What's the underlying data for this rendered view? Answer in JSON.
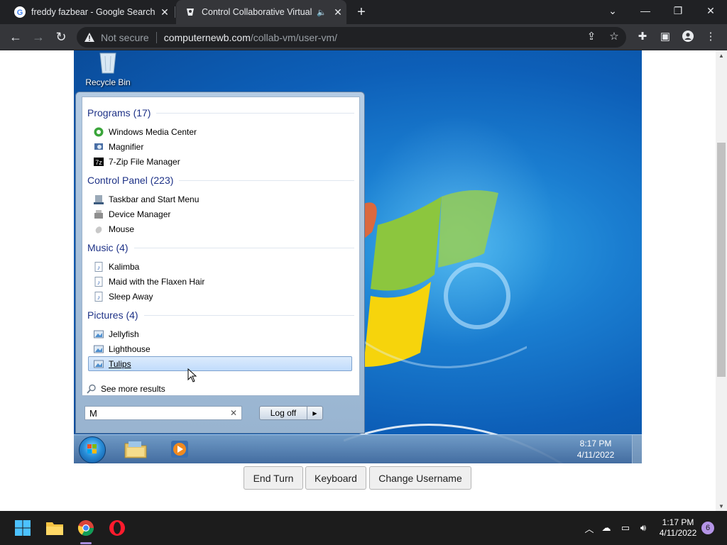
{
  "browser": {
    "tabs": [
      {
        "title": "freddy fazbear - Google Search",
        "favicon": "google-g-icon",
        "active": false
      },
      {
        "title": "Control Collaborative Virtual",
        "favicon": "collabvm-icon",
        "active": true
      }
    ],
    "security_label": "Not secure",
    "url_host": "computernewb.com",
    "url_path": "/collab-vm/user-vm/"
  },
  "desktop": {
    "recycle_bin_label": "Recycle Bin"
  },
  "start_menu": {
    "categories": [
      {
        "heading": "Programs (17)",
        "items": [
          {
            "label": "Windows Media Center",
            "icon": "media-center-icon"
          },
          {
            "label": "Magnifier",
            "icon": "magnifier-icon"
          },
          {
            "label": "7-Zip File Manager",
            "icon": "7zip-icon"
          }
        ]
      },
      {
        "heading": "Control Panel (223)",
        "items": [
          {
            "label": "Taskbar and Start Menu",
            "icon": "taskbar-icon"
          },
          {
            "label": "Device Manager",
            "icon": "device-manager-icon"
          },
          {
            "label": "Mouse",
            "icon": "mouse-icon"
          }
        ]
      },
      {
        "heading": "Music (4)",
        "items": [
          {
            "label": "Kalimba",
            "icon": "music-file-icon"
          },
          {
            "label": "Maid with the Flaxen Hair",
            "icon": "music-file-icon"
          },
          {
            "label": "Sleep Away",
            "icon": "music-file-icon"
          }
        ]
      },
      {
        "heading": "Pictures (4)",
        "items": [
          {
            "label": "Jellyfish",
            "icon": "picture-file-icon"
          },
          {
            "label": "Lighthouse",
            "icon": "picture-file-icon"
          },
          {
            "label": "Tulips",
            "icon": "picture-file-icon",
            "selected": true
          }
        ]
      }
    ],
    "see_more": "See more results",
    "search_value": "M",
    "log_off_label": "Log off"
  },
  "vm_taskbar": {
    "time": "8:17 PM",
    "date": "4/11/2022"
  },
  "vm_controls": {
    "end_turn": "End Turn",
    "keyboard": "Keyboard",
    "change_username": "Change Username"
  },
  "win11_taskbar": {
    "time": "1:17 PM",
    "date": "4/11/2022",
    "notification_count": "6"
  },
  "colors": {
    "chrome_dark": "#202124",
    "chrome_toolbar": "#35363a",
    "win7_heading": "#1e3287",
    "win11_taskbar": "#1c1c1c",
    "notif_badge": "#b494e6"
  }
}
